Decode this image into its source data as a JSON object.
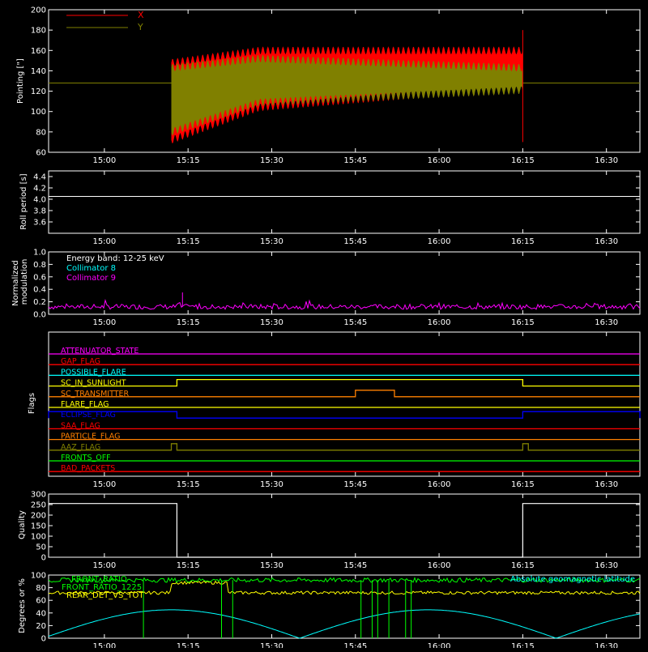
{
  "time_axis": {
    "start": "14:50",
    "end": "16:36",
    "ticks": [
      "15:00",
      "15:15",
      "15:30",
      "15:45",
      "16:00",
      "16:15",
      "16:30"
    ]
  },
  "colors": {
    "background": "#000000",
    "axes": "#ffffff",
    "x_pointing": "#ff0000",
    "y_pointing": "#808000",
    "collimator8": "#00ffff",
    "collimator9": "#ff00ff",
    "quality": "#ffffff",
    "front_ratio": "#00ff00",
    "rear_ratio": "#ffff00",
    "latitude": "#00ffff"
  },
  "chart_data": [
    {
      "type": "line",
      "panel": "pointing",
      "ylabel": "Pointing [\"]",
      "ylim": [
        60,
        200
      ],
      "yticks": [
        60,
        80,
        100,
        120,
        140,
        160,
        180,
        200
      ],
      "legend": [
        "X",
        "Y"
      ],
      "series": [
        {
          "name": "X",
          "envelope_start": "15:12",
          "envelope_end": "16:15",
          "upper_start": 160,
          "upper_end": 160,
          "lower_start": 72,
          "lower_end": 100,
          "baseline": 128
        },
        {
          "name": "Y",
          "envelope_start": "15:12",
          "envelope_end": "16:15",
          "upper_start": 155,
          "upper_end": 143,
          "lower_start": 80,
          "lower_end": 96,
          "baseline": 128
        }
      ]
    },
    {
      "type": "line",
      "panel": "roll",
      "ylabel": "Roll period [s]",
      "ylim": [
        3.4,
        4.5
      ],
      "yticks": [
        "3.6",
        "3.8",
        "4.0",
        "4.2",
        "4.4"
      ],
      "series": [
        {
          "name": "",
          "value": 4.05
        }
      ]
    },
    {
      "type": "line",
      "panel": "modulation",
      "ylabel": "Normalized modulation",
      "ylim": [
        0,
        1.0
      ],
      "yticks": [
        "0.0",
        "0.2",
        "0.4",
        "0.6",
        "0.8",
        "1.0"
      ],
      "annotations": [
        "Energy band: 12-25 keV",
        "Collimator 8",
        "Collimator 9"
      ],
      "series": [
        {
          "name": "Collimator 9",
          "mean": 0.12,
          "spike_time": "15:14",
          "spike_value": 0.35
        }
      ]
    },
    {
      "type": "line",
      "panel": "flags",
      "ylabel": "Flags",
      "flags": [
        {
          "label": "ATTENUATOR_STATE",
          "color": "#ff00ff",
          "segments": []
        },
        {
          "label": "GAP_FLAG",
          "color": "#ff0000",
          "segments": []
        },
        {
          "label": "POSSIBLE_FLARE",
          "color": "#00ffff",
          "segments": []
        },
        {
          "label": "SC_IN_SUNLIGHT",
          "color": "#ffff00",
          "segments": [
            [
              "15:13",
              "16:15"
            ]
          ]
        },
        {
          "label": "SC_TRANSMITTER",
          "color": "#ff8000",
          "segments": [
            [
              "15:45",
              "15:52"
            ]
          ]
        },
        {
          "label": "FLARE_FLAG",
          "color": "#ffff00",
          "segments": []
        },
        {
          "label": "ECLIPSE_FLAG",
          "color": "#0000ff",
          "segments": [
            [
              "14:50",
              "15:13"
            ],
            [
              "16:15",
              "16:36"
            ]
          ]
        },
        {
          "label": "SAA_FLAG",
          "color": "#ff0000",
          "segments": []
        },
        {
          "label": "PARTICLE_FLAG",
          "color": "#ff8000",
          "segments": []
        },
        {
          "label": "AAZ_FLAG",
          "color": "#808000",
          "segments": [
            [
              "15:12",
              "15:13"
            ],
            [
              "16:15",
              "16:16"
            ]
          ]
        },
        {
          "label": "FRONTS_OFF",
          "color": "#00ff00",
          "segments": []
        },
        {
          "label": "BAD_PACKETS",
          "color": "#ff0000",
          "segments": []
        }
      ]
    },
    {
      "type": "line",
      "panel": "quality",
      "ylabel": "Quality",
      "ylim": [
        0,
        300
      ],
      "yticks": [
        "0",
        "50",
        "100",
        "150",
        "200",
        "250",
        "300"
      ],
      "series": [
        {
          "name": "",
          "steps": [
            [
              "14:50",
              255
            ],
            [
              "15:13",
              0
            ],
            [
              "16:15",
              255
            ]
          ]
        }
      ]
    },
    {
      "type": "line",
      "panel": "ratios",
      "ylabel": "Degrees or %",
      "ylim": [
        0,
        100
      ],
      "yticks": [
        "0",
        "20",
        "40",
        "60",
        "80",
        "100"
      ],
      "legend": [
        "FRONT_RATIO",
        "FRONT_RATIO_1225",
        "REAR_DET_VS_TOT"
      ],
      "right_legend": "Absolute geomagnetic latitude",
      "series": [
        {
          "name": "FRONT_RATIO",
          "level": 92
        },
        {
          "name": "REAR_DET_VS_TOT",
          "level": 72
        },
        {
          "name": "Absolute geomagnetic latitude",
          "peak": 45
        }
      ]
    }
  ]
}
